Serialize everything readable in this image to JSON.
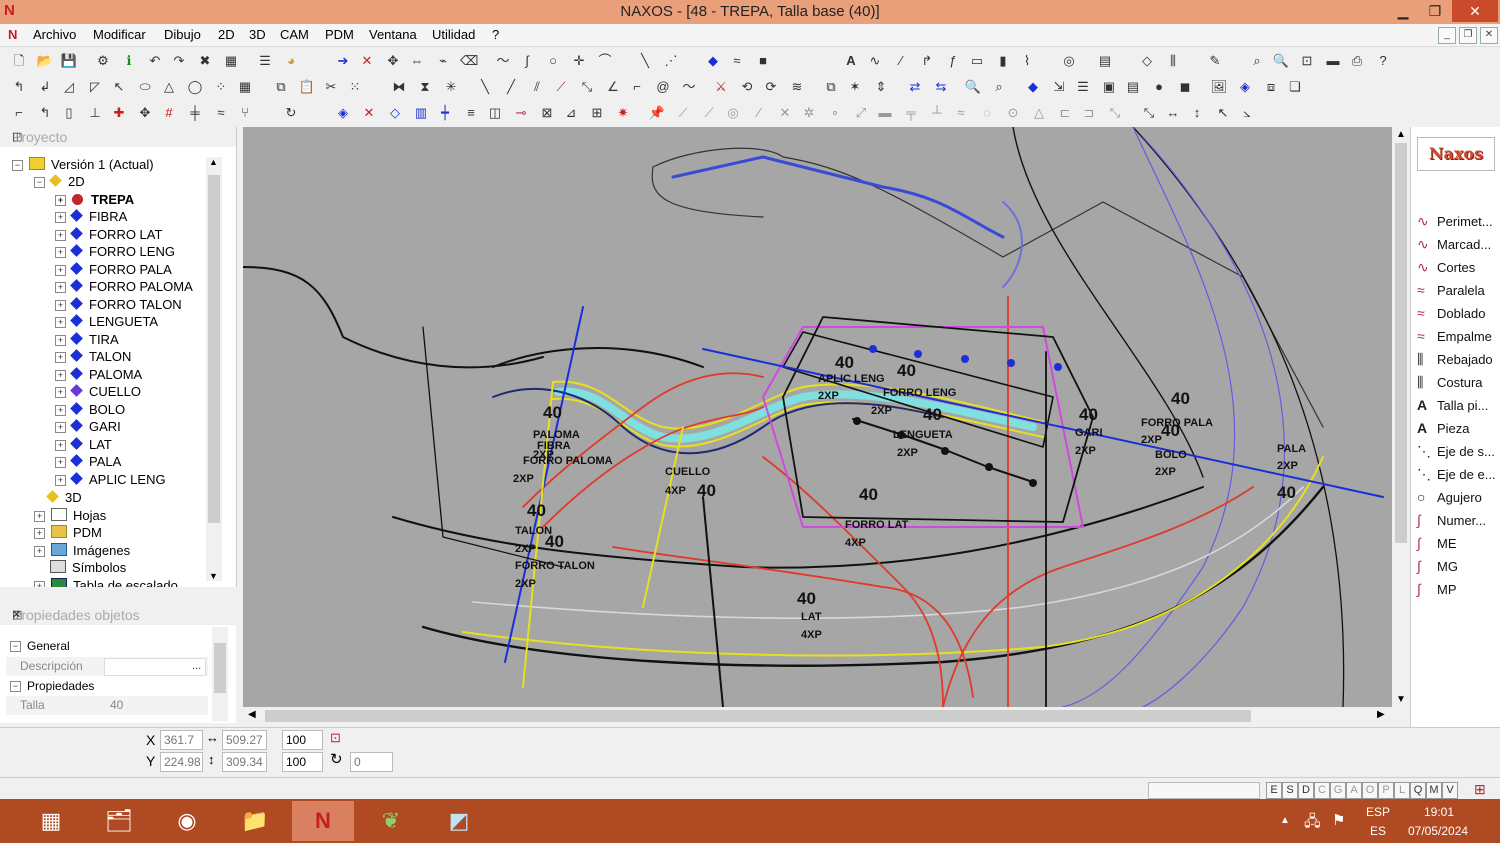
{
  "window": {
    "title": "NAXOS - [48 - TREPA, Talla base (40)]",
    "app_icon": "N",
    "min": "▁",
    "max": "❐",
    "close": "✕"
  },
  "menu": [
    "Archivo",
    "Modificar",
    "Dibujo",
    "2D",
    "3D",
    "CAM",
    "PDM",
    "Ventana",
    "Utilidad",
    "?"
  ],
  "project_pane": {
    "header": "Proyecto",
    "tree": {
      "version": "Versión 1 (Actual)",
      "node_2d": "2D",
      "pieces": [
        "TREPA",
        "FIBRA",
        "FORRO LAT",
        "FORRO LENG",
        "FORRO PALA",
        "FORRO PALOMA",
        "FORRO TALON",
        "LENGUETA",
        "TIRA",
        "TALON",
        "PALOMA",
        "CUELLO",
        "BOLO",
        "GARI",
        "LAT",
        "PALA",
        "APLIC LENG"
      ],
      "node_3d": "3D",
      "others": [
        "Hojas",
        "PDM",
        "Imágenes",
        "Símbolos",
        "Tabla de escalado"
      ]
    }
  },
  "props_pane": {
    "header": "Propiedades objetos",
    "general": "General",
    "descripcion_label": "Descripción",
    "descripcion_value": "",
    "propiedades": "Propiedades",
    "talla_label": "Talla",
    "talla_value": "40"
  },
  "right_panel": {
    "logo": "Naxos",
    "items": [
      "Perimet...",
      "Marcad...",
      "Cortes",
      "Paralela",
      "Doblado",
      "Empalme",
      "Rebajado",
      "Costura",
      "Talla pi...",
      "Pieza",
      "Eje de s...",
      "Eje de e...",
      "Agujero",
      "Numer...",
      "ME",
      "MG",
      "MP"
    ]
  },
  "canvas_labels": [
    {
      "text": "40",
      "id": "a"
    },
    {
      "text": "40",
      "id": "b"
    },
    {
      "text": "APLIC LENG",
      "id": "c"
    },
    {
      "text": "2XP",
      "id": "d"
    },
    {
      "text": "FORRO LENG",
      "id": "e"
    },
    {
      "text": "40",
      "id": "f"
    },
    {
      "text": "2XP",
      "id": "g"
    },
    {
      "text": "LENGUETA",
      "id": "h"
    },
    {
      "text": "2XP",
      "id": "i"
    },
    {
      "text": "40",
      "id": "j"
    },
    {
      "text": "GARI",
      "id": "k"
    },
    {
      "text": "2XP",
      "id": "l"
    },
    {
      "text": "40",
      "id": "m"
    },
    {
      "text": "FORRO PALA",
      "id": "n"
    },
    {
      "text": "2XP",
      "id": "o"
    },
    {
      "text": "40",
      "id": "p"
    },
    {
      "text": "BOLO",
      "id": "q"
    },
    {
      "text": "2XP",
      "id": "r"
    },
    {
      "text": "PALA",
      "id": "s"
    },
    {
      "text": "2XP",
      "id": "t"
    },
    {
      "text": "40",
      "id": "u"
    },
    {
      "text": "40",
      "id": "v"
    },
    {
      "text": "PALOMA",
      "id": "w"
    },
    {
      "text": "FIBRA",
      "id": "x"
    },
    {
      "text": "2XP",
      "id": "y"
    },
    {
      "text": "FORRO PALOMA",
      "id": "z"
    },
    {
      "text": "2XP",
      "id": "aa"
    },
    {
      "text": "CUELLO",
      "id": "ab"
    },
    {
      "text": "4XP",
      "id": "ac"
    },
    {
      "text": "40",
      "id": "ad"
    },
    {
      "text": "40",
      "id": "ae"
    },
    {
      "text": "FORRO LAT",
      "id": "af"
    },
    {
      "text": "4XP",
      "id": "ag"
    },
    {
      "text": "40",
      "id": "ah"
    },
    {
      "text": "TALON",
      "id": "ai"
    },
    {
      "text": "2XP",
      "id": "aj"
    },
    {
      "text": "40",
      "id": "ak"
    },
    {
      "text": "FORRO TALON",
      "id": "al"
    },
    {
      "text": "2XP",
      "id": "am"
    },
    {
      "text": "40",
      "id": "an"
    },
    {
      "text": "LAT",
      "id": "ao"
    },
    {
      "text": "4XP",
      "id": "ap"
    }
  ],
  "coords": {
    "x_label": "X",
    "x": "361.7",
    "y_label": "Y",
    "y": "224.98",
    "w": "509.27",
    "h": "309.34",
    "scale1": "100",
    "scale2": "100",
    "rot": "0"
  },
  "status_keys": [
    "E",
    "S",
    "D",
    "C",
    "G",
    "A",
    "O",
    "P",
    "L",
    "Q",
    "M",
    "V"
  ],
  "tray": {
    "lang": "ESP",
    "layout": "ES",
    "time": "19:01",
    "date": "07/05/2024"
  },
  "colors": {
    "titlebar": "#e9a07a",
    "taskbar": "#b04a22",
    "canvas": "#a6a6a6",
    "close": "#c94b2c"
  }
}
